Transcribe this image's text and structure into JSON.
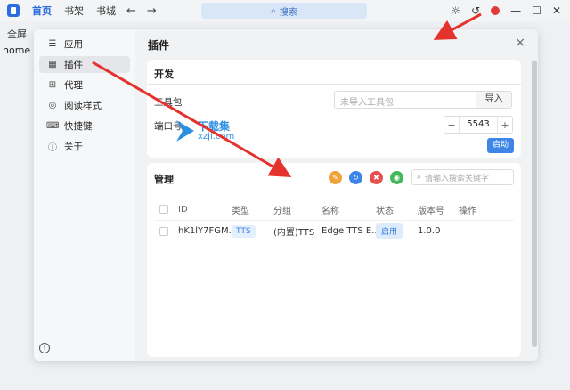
{
  "topbar": {
    "nav": [
      "首页",
      "书架",
      "书城"
    ],
    "back_icon": "←",
    "forward_icon": "→",
    "search_placeholder": "搜索"
  },
  "background": {
    "tab_label": "全屏",
    "home_text": "home"
  },
  "sidebar": {
    "items": [
      {
        "label": "应用",
        "icon": "sliders-icon"
      },
      {
        "label": "插件",
        "icon": "grid-icon"
      },
      {
        "label": "代理",
        "icon": "network-icon"
      },
      {
        "label": "阅读样式",
        "icon": "palette-icon"
      },
      {
        "label": "快捷键",
        "icon": "keyboard-icon"
      },
      {
        "label": "关于",
        "icon": "info-icon"
      }
    ],
    "active_index": 1
  },
  "page": {
    "title": "插件",
    "close_icon": "×"
  },
  "dev_card": {
    "title": "开发",
    "toolkit_label": "工具包",
    "import_placeholder": "未导入工具包",
    "import_button": "导入",
    "port_label": "端口号",
    "port_value": "5543",
    "minus": "−",
    "plus": "+",
    "start_button": "启动"
  },
  "manage_card": {
    "title": "管理",
    "search_placeholder": "请输入搜索关键字",
    "action_colors": [
      "#f0a33a",
      "#3d86e8",
      "#e85050",
      "#45b85a"
    ],
    "headers": [
      "ID",
      "类型",
      "分组",
      "名称",
      "状态",
      "版本号",
      "操作"
    ],
    "rows": [
      {
        "id": "hK1lY7FGM...",
        "type": "TTS",
        "group": "(内置)TTS",
        "name": "Edge TTS E...",
        "status": "启用",
        "version": "1.0.0"
      }
    ]
  },
  "watermark": {
    "text": "下载集",
    "url": "xzji.com"
  },
  "colors": {
    "accent": "#2b6cde",
    "arrow": "#e5322d"
  }
}
